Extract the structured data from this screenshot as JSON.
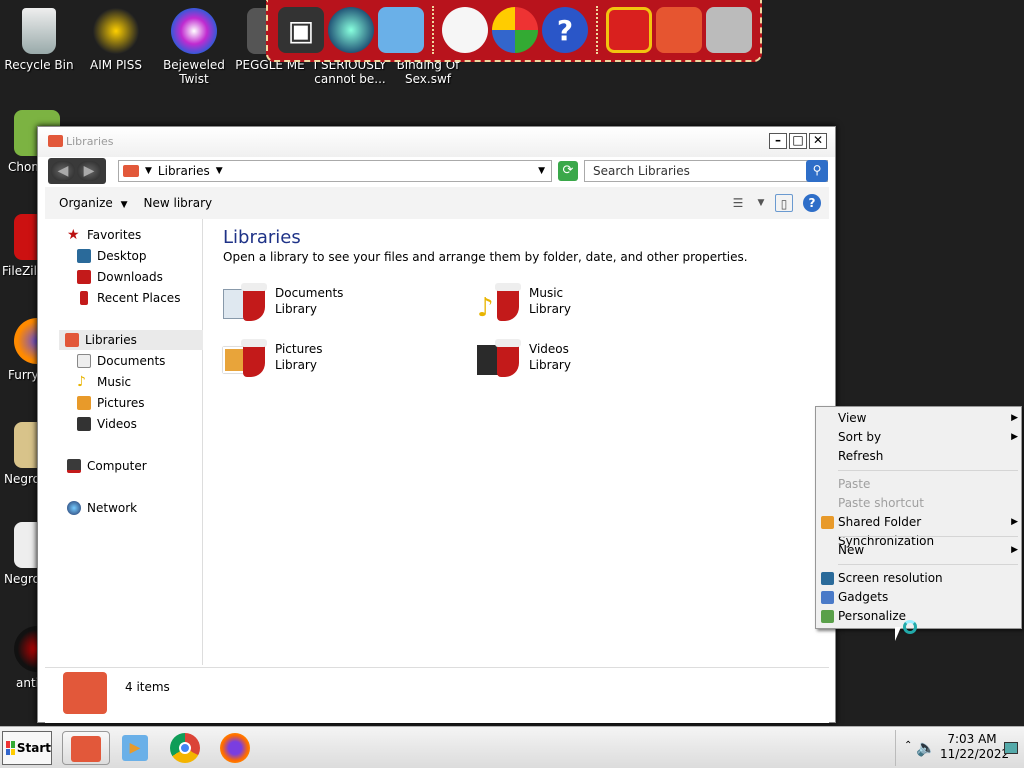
{
  "desktop_icons": [
    {
      "label": "Recycle Bin"
    },
    {
      "label": "AIM PISS"
    },
    {
      "label": "Bejeweled Twist"
    },
    {
      "label": "PEGGLE ME"
    },
    {
      "label": "I SERIOUSLY cannot be..."
    },
    {
      "label": "Binding Of Sex.swf"
    },
    {
      "label": "Chom"
    },
    {
      "label": "FileZill"
    },
    {
      "label": "Furry"
    },
    {
      "label": "Negro"
    },
    {
      "label": "Negro"
    },
    {
      "label": "anti"
    }
  ],
  "window": {
    "title": "Libraries",
    "address": "Libraries",
    "search_placeholder": "Search Libraries",
    "toolbar": {
      "organize": "Organize",
      "new_library": "New library"
    },
    "nav": {
      "favorites": "Favorites",
      "desktop": "Desktop",
      "downloads": "Downloads",
      "recent": "Recent Places",
      "libraries": "Libraries",
      "documents": "Documents",
      "music": "Music",
      "pictures": "Pictures",
      "videos": "Videos",
      "computer": "Computer",
      "network": "Network"
    },
    "content": {
      "heading": "Libraries",
      "subheading": "Open a library to see your files and arrange them by folder, date, and other properties.",
      "items": [
        {
          "name": "Documents",
          "type": "Library"
        },
        {
          "name": "Music",
          "type": "Library"
        },
        {
          "name": "Pictures",
          "type": "Library"
        },
        {
          "name": "Videos",
          "type": "Library"
        }
      ]
    },
    "status": "4 items"
  },
  "context_menu": {
    "view": "View",
    "sort_by": "Sort by",
    "refresh": "Refresh",
    "paste": "Paste",
    "paste_shortcut": "Paste shortcut",
    "shared_folder_sync": "Shared Folder Synchronization",
    "new": "New",
    "screen_resolution": "Screen resolution",
    "gadgets": "Gadgets",
    "personalize": "Personalize"
  },
  "taskbar": {
    "start": "Start",
    "time": "7:03 AM",
    "date": "11/22/2022"
  }
}
